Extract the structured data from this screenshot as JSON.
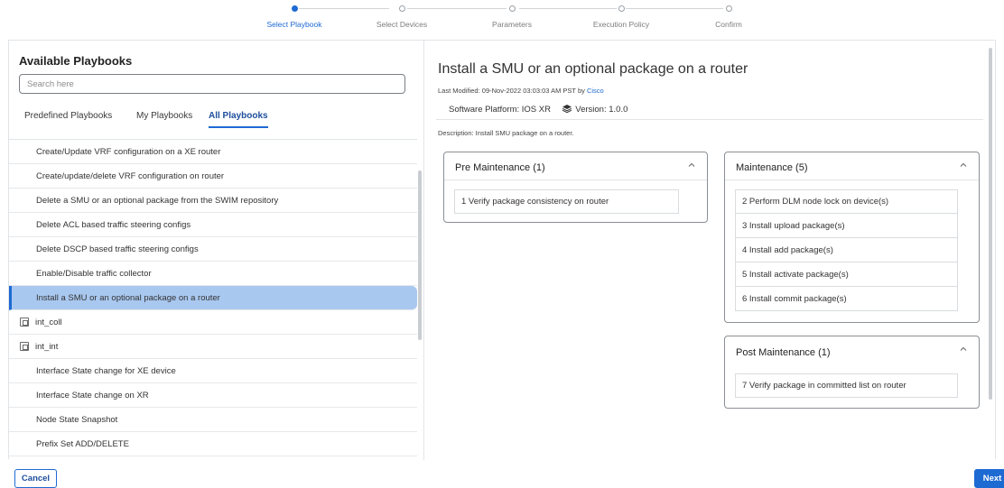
{
  "stepper": {
    "steps": [
      {
        "label": "Select Playbook",
        "active": true
      },
      {
        "label": "Select Devices",
        "active": false
      },
      {
        "label": "Parameters",
        "active": false
      },
      {
        "label": "Execution Policy",
        "active": false
      },
      {
        "label": "Confirm",
        "active": false
      }
    ]
  },
  "left": {
    "title": "Available Playbooks",
    "search_placeholder": "Search here",
    "tabs": [
      {
        "label": "Predefined Playbooks",
        "active": false
      },
      {
        "label": "My Playbooks",
        "active": false
      },
      {
        "label": "All Playbooks",
        "active": true
      }
    ],
    "items": [
      {
        "label": "Create/Update VRF configuration on a XE router",
        "icon": false,
        "selected": false
      },
      {
        "label": "Create/update/delete VRF configuration on router",
        "icon": false,
        "selected": false
      },
      {
        "label": "Delete a SMU or an optional package from the SWIM repository",
        "icon": false,
        "selected": false
      },
      {
        "label": "Delete ACL based traffic steering configs",
        "icon": false,
        "selected": false
      },
      {
        "label": "Delete DSCP based traffic steering configs",
        "icon": false,
        "selected": false
      },
      {
        "label": "Enable/Disable traffic collector",
        "icon": false,
        "selected": false
      },
      {
        "label": "Install a SMU or an optional package on a router",
        "icon": false,
        "selected": true
      },
      {
        "label": "int_coll",
        "icon": true,
        "selected": false
      },
      {
        "label": "int_int",
        "icon": true,
        "selected": false
      },
      {
        "label": "Interface State change for XE device",
        "icon": false,
        "selected": false
      },
      {
        "label": "Interface State change on XR",
        "icon": false,
        "selected": false
      },
      {
        "label": "Node State Snapshot",
        "icon": false,
        "selected": false
      },
      {
        "label": "Prefix Set ADD/DELETE",
        "icon": false,
        "selected": false
      }
    ]
  },
  "right": {
    "title": "Install a SMU or an optional package on a router",
    "modified_prefix": "Last Modified: 09-Nov-2022 03:03:03 AM PST by ",
    "modified_by": "Cisco",
    "platform": "Software Platform:  IOS XR",
    "version": "Version:  1.0.0",
    "description": "Description: Install SMU package on a router.",
    "cards": {
      "pre": {
        "title": "Pre Maintenance (1)",
        "tasks": [
          "1 Verify package consistency on router"
        ]
      },
      "maint": {
        "title": "Maintenance (5)",
        "tasks": [
          "2 Perform DLM node lock on device(s)",
          "3 Install upload package(s)",
          "4 Install add package(s)",
          "5 Install activate package(s)",
          "6 Install commit package(s)"
        ]
      },
      "post": {
        "title": "Post Maintenance (1)",
        "tasks": [
          "7 Verify package in committed list on router"
        ]
      }
    }
  },
  "footer": {
    "cancel_label": "Cancel",
    "next_label": "Next"
  },
  "colors": {
    "accent": "#1e6ad3",
    "selected_row": "#a9c8f0"
  }
}
